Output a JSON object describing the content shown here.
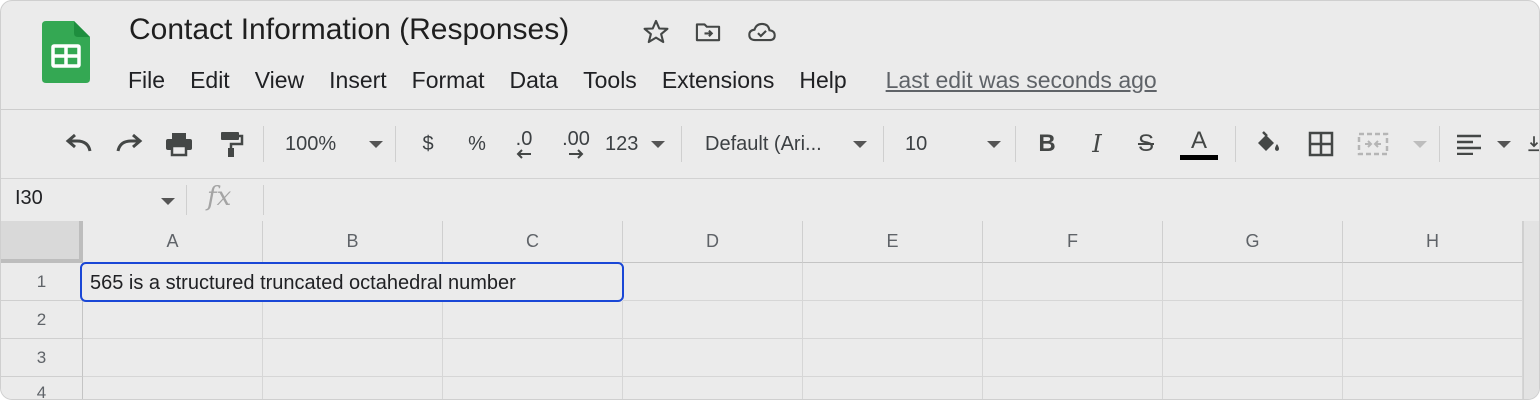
{
  "app": {
    "title": "Contact Information (Responses)",
    "icons": [
      "sheets-logo-icon",
      "star-icon",
      "move-to-folder-icon",
      "cloud-saved-icon"
    ],
    "colors": {
      "logo_green": "#34a853",
      "selection_blue": "#1a47d6"
    }
  },
  "menu": {
    "items": [
      "File",
      "Edit",
      "View",
      "Insert",
      "Format",
      "Data",
      "Tools",
      "Extensions",
      "Help"
    ],
    "last_edit": "Last edit was seconds ago"
  },
  "toolbar": {
    "zoom": "100%",
    "currency": "$",
    "percent": "%",
    "decimal_decrease": ".0",
    "decimal_increase": ".00",
    "more_formats": "123",
    "font": "Default (Ari...",
    "font_size": "10",
    "bold": "B",
    "italic": "I",
    "strike": "S",
    "text_color": "A",
    "icons": [
      "undo-icon",
      "redo-icon",
      "print-icon",
      "paint-format-icon",
      "fill-color-icon",
      "borders-icon",
      "merge-cells-icon",
      "align-left-icon"
    ]
  },
  "formula_bar": {
    "cell_ref": "I30",
    "fx": "fx",
    "value": ""
  },
  "grid": {
    "columns": [
      "A",
      "B",
      "C",
      "D",
      "E",
      "F",
      "G",
      "H"
    ],
    "rows": [
      "1",
      "2",
      "3",
      "4"
    ],
    "cells": {
      "A1": "565 is a structured truncated octahedral number"
    }
  }
}
